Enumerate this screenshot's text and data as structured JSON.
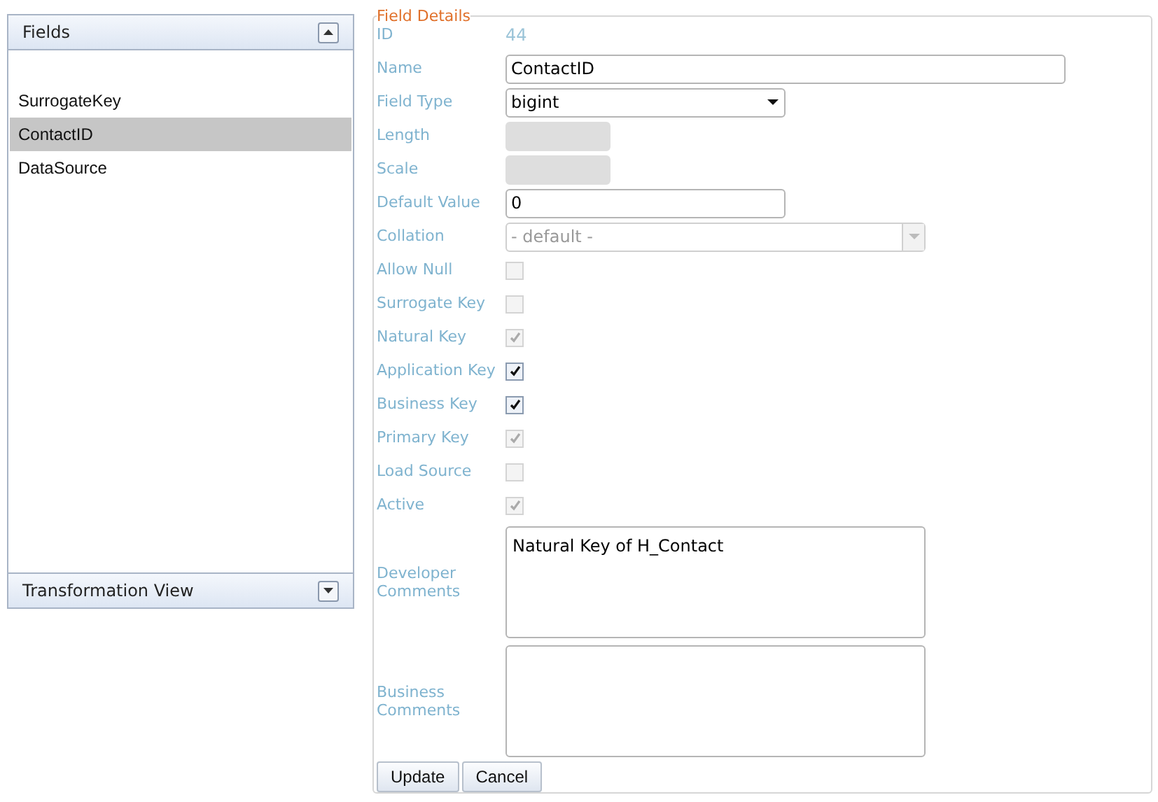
{
  "fields_panel": {
    "title": "Fields",
    "expanded": true,
    "items": [
      {
        "label": "SurrogateKey",
        "selected": false
      },
      {
        "label": "ContactID",
        "selected": true
      },
      {
        "label": "DataSource",
        "selected": false
      }
    ]
  },
  "transformation_panel": {
    "title": "Transformation View",
    "expanded": false
  },
  "field_details": {
    "title": "Field Details",
    "rows": [
      {
        "kind": "text",
        "label": "ID",
        "value": "44"
      },
      {
        "kind": "input",
        "label": "Name",
        "value": "ContactID",
        "disabled": false
      },
      {
        "kind": "select",
        "label": "Field Type",
        "value": "bigint",
        "disabled": false
      },
      {
        "kind": "input",
        "label": "Length",
        "disabled": true
      },
      {
        "kind": "input",
        "label": "Scale",
        "disabled": true
      },
      {
        "kind": "input",
        "label": "Default Value",
        "value": "0",
        "disabled": false
      },
      {
        "kind": "select",
        "label": "Collation",
        "value": "- default -",
        "disabled": true
      },
      {
        "kind": "checkbox",
        "label": "Allow Null",
        "checked": false,
        "disabled": true
      },
      {
        "kind": "checkbox",
        "label": "Surrogate Key",
        "checked": false,
        "disabled": true
      },
      {
        "kind": "checkbox",
        "label": "Natural Key",
        "checked": true,
        "disabled": true
      },
      {
        "kind": "checkbox",
        "label": "Application Key",
        "checked": true,
        "disabled": false
      },
      {
        "kind": "checkbox",
        "label": "Business Key",
        "checked": true,
        "disabled": false
      },
      {
        "kind": "checkbox",
        "label": "Primary Key",
        "checked": true,
        "disabled": true
      },
      {
        "kind": "checkbox",
        "label": "Load Source",
        "checked": false,
        "disabled": true
      },
      {
        "kind": "checkbox",
        "label": "Active",
        "checked": true,
        "disabled": true
      },
      {
        "kind": "textarea",
        "label": "Developer Comments",
        "value": "Natural Key of H_Contact"
      },
      {
        "kind": "textarea",
        "label": "Business Comments"
      }
    ],
    "buttons": [
      "Update",
      "Cancel"
    ]
  }
}
